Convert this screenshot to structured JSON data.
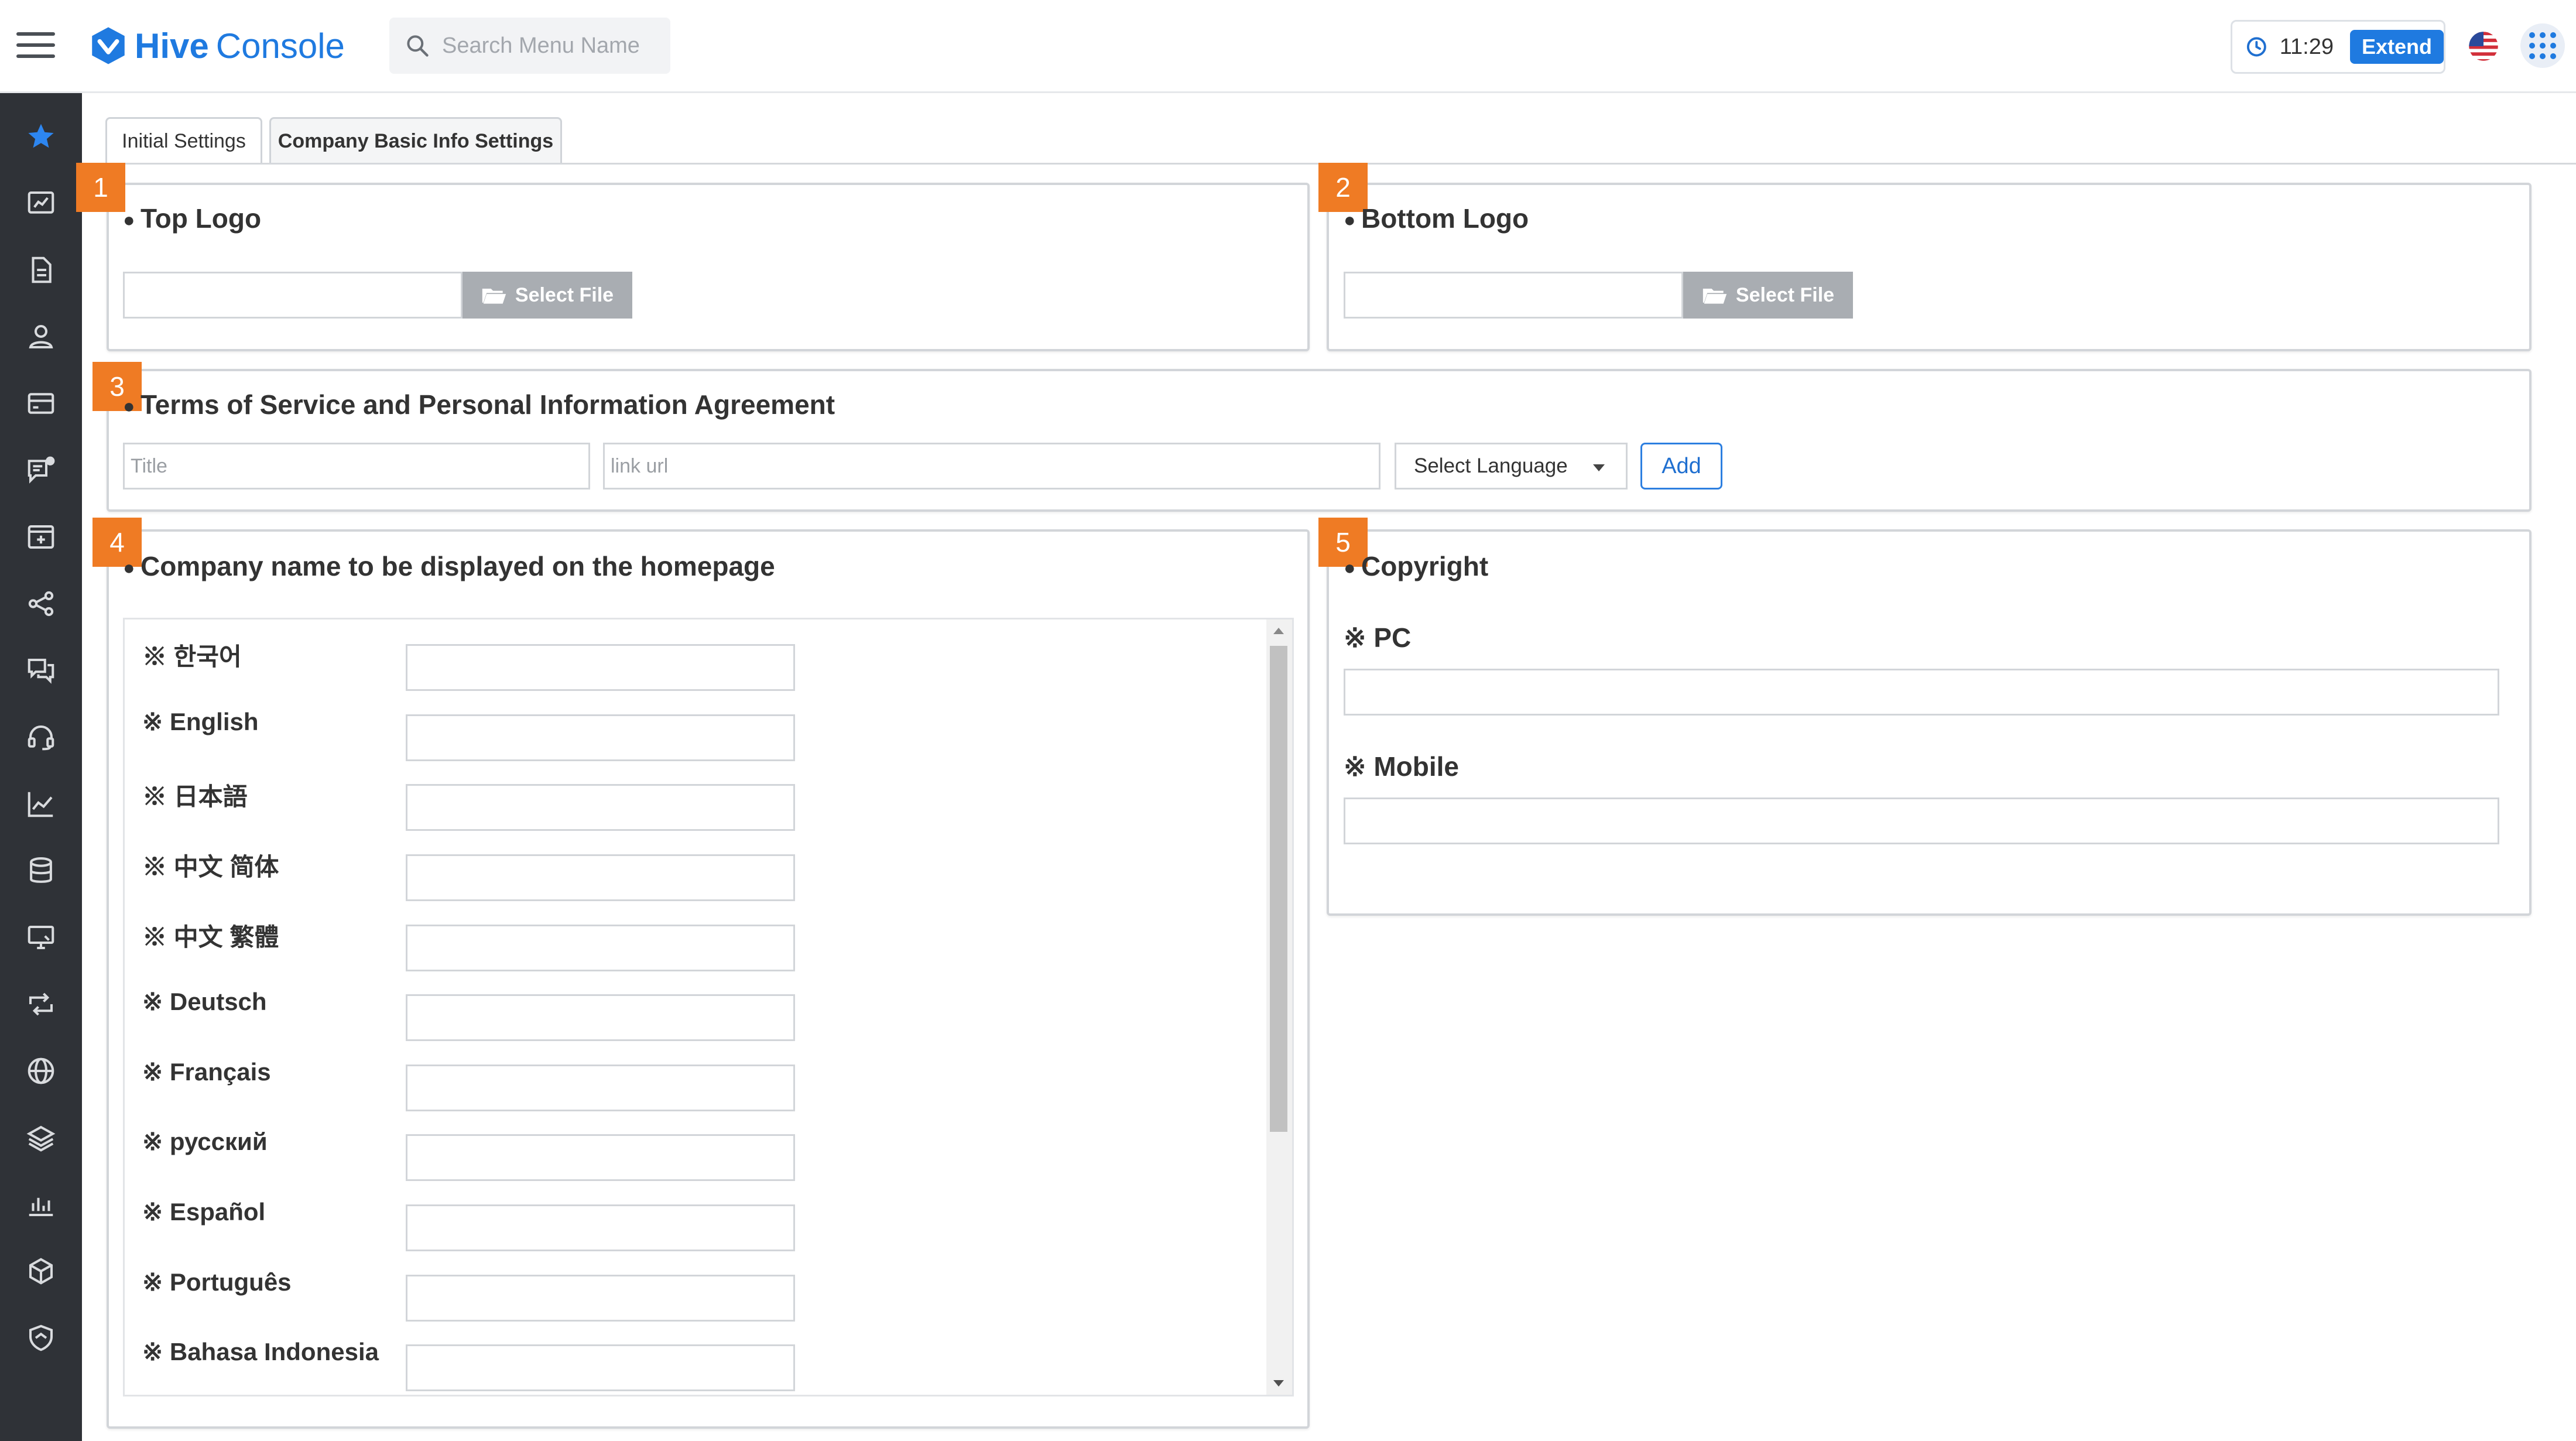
{
  "header": {
    "logo_brand": "Hive",
    "logo_product": "Console",
    "search_placeholder": "Search Menu Name",
    "time": "11:29",
    "extend_label": "Extend",
    "flag_icon": "us-flag-icon",
    "apps_icon": "app-grid-icon"
  },
  "sidebar": {
    "icons": [
      "star-icon",
      "dashboard-icon",
      "document-icon",
      "user-icon",
      "card-icon",
      "message-icon",
      "add-box-icon",
      "share-icon",
      "chat-icon",
      "headset-icon",
      "chart-icon",
      "database-icon",
      "monitor-icon",
      "sync-icon",
      "globe-icon",
      "layers-icon",
      "bar-chart-icon",
      "cube-icon",
      "shield-icon"
    ]
  },
  "tabs": [
    "Initial Settings",
    "Company Basic Info Settings"
  ],
  "sections": {
    "top_logo": {
      "badge": "1",
      "title": "Top Logo",
      "button": "Select File"
    },
    "bottom_logo": {
      "badge": "2",
      "title": "Bottom Logo",
      "button": "Select File"
    },
    "terms": {
      "badge": "3",
      "title": "Terms of Service and Personal Information Agreement",
      "title_placeholder": "Title",
      "url_placeholder": "link url",
      "language_select": "Select Language",
      "add_button": "Add"
    },
    "company_name": {
      "badge": "4",
      "title": "Company name to be displayed on the homepage",
      "languages": [
        "※ 한국어",
        "※ English",
        "※ 日本語",
        "※ 中文 简体",
        "※ 中文 繁體",
        "※ Deutsch",
        "※ Français",
        "※ русский",
        "※ Español",
        "※ Português",
        "※ Bahasa Indonesia"
      ]
    },
    "copyright": {
      "badge": "5",
      "title": "Copyright",
      "pc_label": "※ PC",
      "mobile_label": "※ Mobile"
    }
  },
  "colors": {
    "accent": "#1f7ae0",
    "badge": "#ef7b24",
    "sidebar": "#2f3237"
  }
}
